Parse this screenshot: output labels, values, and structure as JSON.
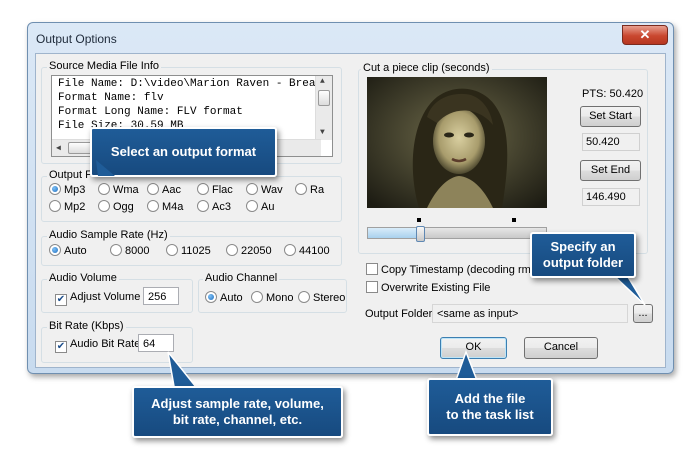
{
  "window": {
    "title": "Output Options",
    "close_glyph": "✕"
  },
  "source_info": {
    "label": "Source Media File Info",
    "lines": [
      "File Name: D:\\video\\Marion Raven - Brea",
      "Format Name: flv",
      "Format Long Name: FLV format",
      "File Size: 30.59 MB"
    ]
  },
  "output_format": {
    "label": "Output F",
    "options": [
      "Mp3",
      "Wma",
      "Aac",
      "Flac",
      "Wav",
      "Ra",
      "Mp2",
      "Ogg",
      "M4a",
      "Ac3",
      "Au"
    ],
    "selected": "Mp3"
  },
  "sample_rate": {
    "label": "Audio Sample Rate (Hz)",
    "options": [
      "Auto",
      "8000",
      "11025",
      "22050",
      "44100"
    ],
    "selected": "Auto"
  },
  "volume": {
    "label": "Audio Volume",
    "checkbox_label": "Adjust Volume",
    "checked": true,
    "value": "256"
  },
  "channel": {
    "label": "Audio Channel",
    "options": [
      "Auto",
      "Mono",
      "Stereo"
    ],
    "selected": "Auto"
  },
  "bitrate": {
    "label": "Bit Rate (Kbps)",
    "checkbox_label": "Audio Bit Rate",
    "checked": true,
    "value": "64"
  },
  "clip": {
    "label": "Cut a piece clip (seconds)",
    "pts": "PTS: 50.420",
    "set_start": "Set Start",
    "start_value": "50.420",
    "set_end": "Set End",
    "end_value": "146.490",
    "slider_fraction": 0.29
  },
  "options": {
    "copy_timestamp": "Copy Timestamp (decoding rm/rm",
    "overwrite": "Overwrite Existing File"
  },
  "output_folder": {
    "label": "Output Folder",
    "value": "<same as input>",
    "browse": "..."
  },
  "buttons": {
    "ok": "OK",
    "cancel": "Cancel"
  },
  "callouts": {
    "format": "Select an output format",
    "folder": [
      "Specify an",
      "output folder"
    ],
    "adjust": [
      "Adjust sample rate, volume,",
      "bit rate, channel, etc."
    ],
    "add": [
      "Add the file",
      "to the task list"
    ]
  },
  "colors": {
    "callout": "#1f5c98",
    "window_frame": "#dbe8f6",
    "close": "#c9472f"
  },
  "icons": {
    "close": "close-icon"
  }
}
